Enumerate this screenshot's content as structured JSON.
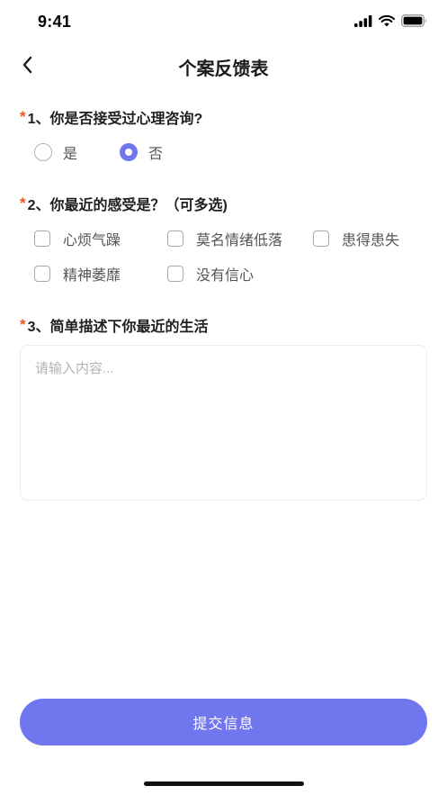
{
  "status_bar": {
    "time": "9:41",
    "icons": [
      "signal-icon",
      "wifi-icon",
      "battery-icon"
    ]
  },
  "nav": {
    "back_icon": "chevron-left-icon",
    "title": "个案反馈表"
  },
  "question1": {
    "required": "*",
    "title": "1、你是否接受过心理咨询?",
    "options": [
      {
        "label": "是",
        "selected": false
      },
      {
        "label": "否",
        "selected": true
      }
    ]
  },
  "question2": {
    "required": "*",
    "title": "2、你最近的感受是？（可多选)",
    "options": [
      {
        "label": "心烦气躁",
        "checked": false
      },
      {
        "label": "莫名情绪低落",
        "checked": false
      },
      {
        "label": "患得患失",
        "checked": false
      },
      {
        "label": "精神萎靡",
        "checked": false
      },
      {
        "label": "没有信心",
        "checked": false
      }
    ]
  },
  "question3": {
    "required": "*",
    "title": "3、简单描述下你最近的生活",
    "placeholder": "请输入内容...",
    "value": ""
  },
  "submit": {
    "label": "提交信息"
  },
  "colors": {
    "accent": "#7076ee",
    "required": "#f0551c",
    "text": "#1f1f1f",
    "option_text": "#555555",
    "placeholder": "#b3b3b3"
  }
}
